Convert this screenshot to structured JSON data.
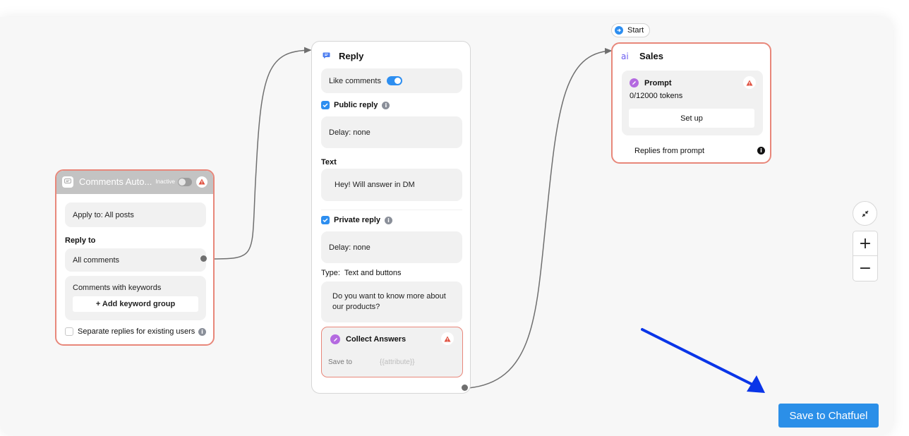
{
  "colors": {
    "canvas_bg": "#f7f7f7",
    "error_border": "#e8877a",
    "accent_blue": "#2d8ef0",
    "save_button": "#2b8fe8",
    "annotation_arrow": "#0a35e8",
    "warning": "#e0503f",
    "purple": "#b46ae0"
  },
  "start_badge": {
    "label": "Start",
    "icon": "arrow-right-circle-icon"
  },
  "comments_node": {
    "title": "Comments Auto...",
    "status_label": "Inactive",
    "toggle_on": false,
    "apply_to": "Apply to: All posts",
    "reply_to_label": "Reply to",
    "all_comments": "All comments",
    "keywords_label": "Comments with keywords",
    "add_keyword_button": "+ Add keyword group",
    "separate_replies_label": "Separate replies for existing users",
    "separate_replies_checked": false
  },
  "reply_node": {
    "title": "Reply",
    "like_comments_label": "Like comments",
    "like_comments_on": true,
    "public_reply_label": "Public reply",
    "public_reply_checked": true,
    "public_delay": "Delay: none",
    "text_label": "Text",
    "text_value": "Hey! Will answer in DM",
    "private_reply_label": "Private reply",
    "private_reply_checked": true,
    "private_delay": "Delay: none",
    "type_label": "Type:  Text and buttons",
    "message_text": "Do you want to know more about our products?",
    "collect_answers": {
      "title": "Collect Answers",
      "save_to_label": "Save to",
      "save_to_placeholder": "{{attribute}}"
    }
  },
  "sales_node": {
    "title": "Sales",
    "icon_text": "ai",
    "prompt_title": "Prompt",
    "tokens": "0/12000 tokens",
    "setup_button": "Set up",
    "replies_label": "Replies from prompt"
  },
  "zoom_controls": {
    "fit_icon": "collapse-arrows-icon",
    "zoom_in": "+",
    "zoom_out": "−"
  },
  "save_button": {
    "label": "Save to Chatfuel"
  }
}
